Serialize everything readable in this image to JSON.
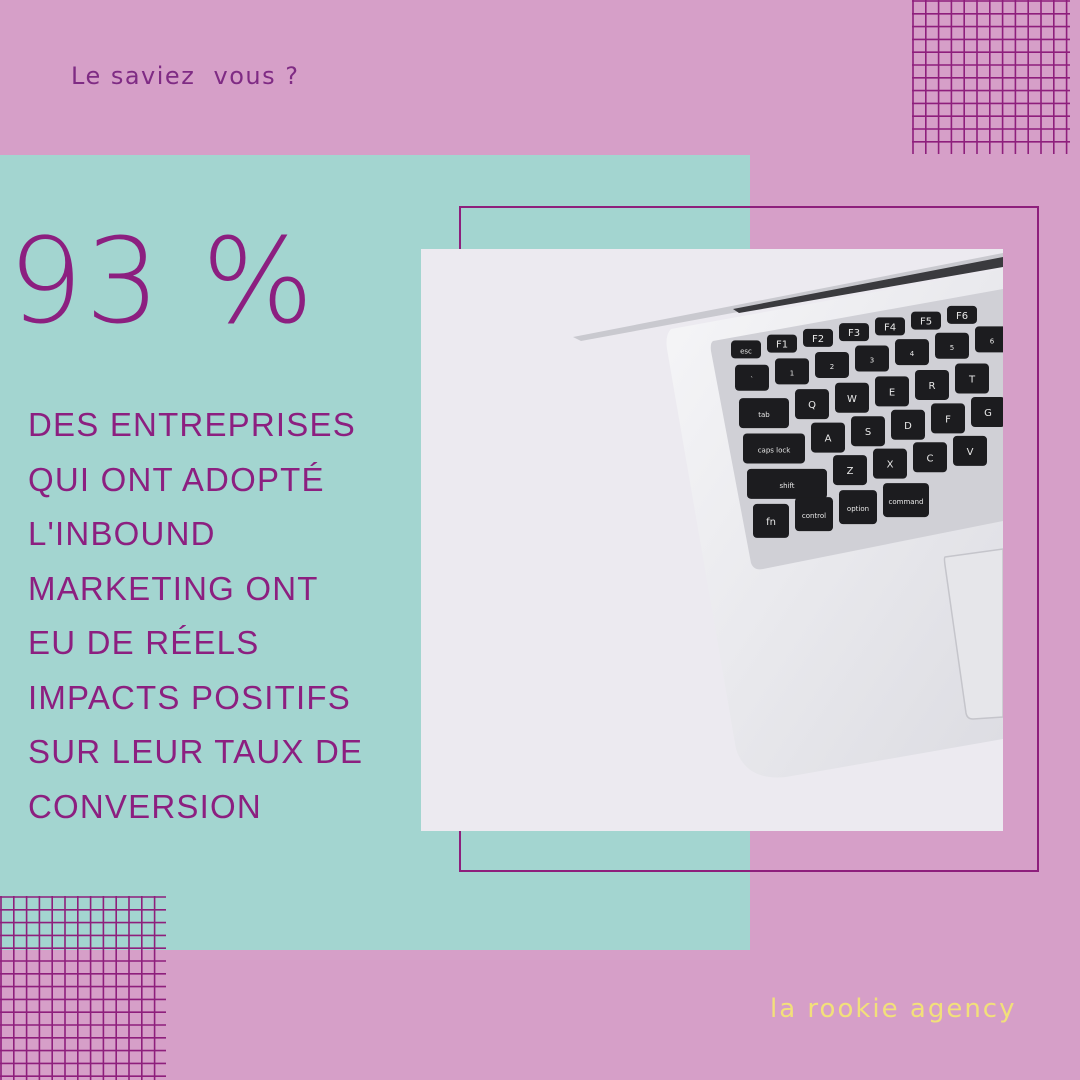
{
  "kicker": "Le saviez  vous ?",
  "stat": "93 %",
  "description_lines": [
    "DES ENTREPRISES",
    "QUI ONT ADOPTÉ",
    "L'INBOUND",
    "MARKETING ONT",
    "EU DE RÉELS",
    "IMPACTS POSITIFS",
    "SUR LEUR TAUX DE",
    "CONVERSION"
  ],
  "brand": "la rookie agency",
  "keyboard": {
    "row0": [
      "esc",
      "F1",
      "F2",
      "F3",
      "F4",
      "F5",
      "F6"
    ],
    "row1": [
      "~\n`",
      "!\n1",
      "@\n2",
      "#\n3",
      "$\n4",
      "%\n5",
      "^\n6"
    ],
    "row2": [
      "tab",
      "Q",
      "W",
      "E",
      "R",
      "T"
    ],
    "row3": [
      "caps lock",
      "A",
      "S",
      "D",
      "F",
      "G"
    ],
    "row4": [
      "shift",
      "Z",
      "X",
      "C",
      "V"
    ],
    "row5": [
      "fn",
      "control",
      "option",
      "command"
    ]
  },
  "colors": {
    "pink_background": "#d69fc8",
    "teal_panel": "#a3d5d0",
    "purple_text": "#8c1f80",
    "brand_yellow": "#f2e07a"
  }
}
